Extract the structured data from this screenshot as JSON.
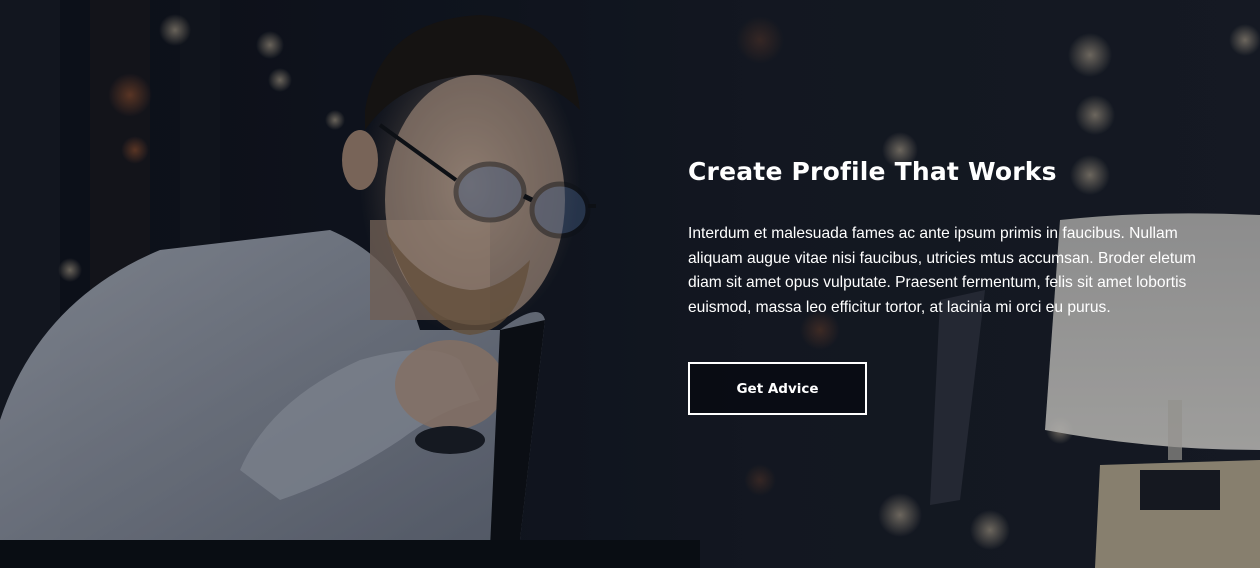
{
  "hero": {
    "title": "Create Profile That Works",
    "description": "Interdum et malesuada fames ac ante ipsum primis in faucibus. Nullam aliquam augue vitae nisi faucibus, utricies mtus accumsan. Broder eletum diam sit amet opus vulputate. Praesent fermentum, felis sit amet lobortis euismod, massa leo efficitur tortor, at lacinia mi orci eu purus.",
    "cta_label": "Get Advice"
  },
  "colors": {
    "text": "#ffffff",
    "background": "#0d111b",
    "button_border": "#ffffff"
  }
}
